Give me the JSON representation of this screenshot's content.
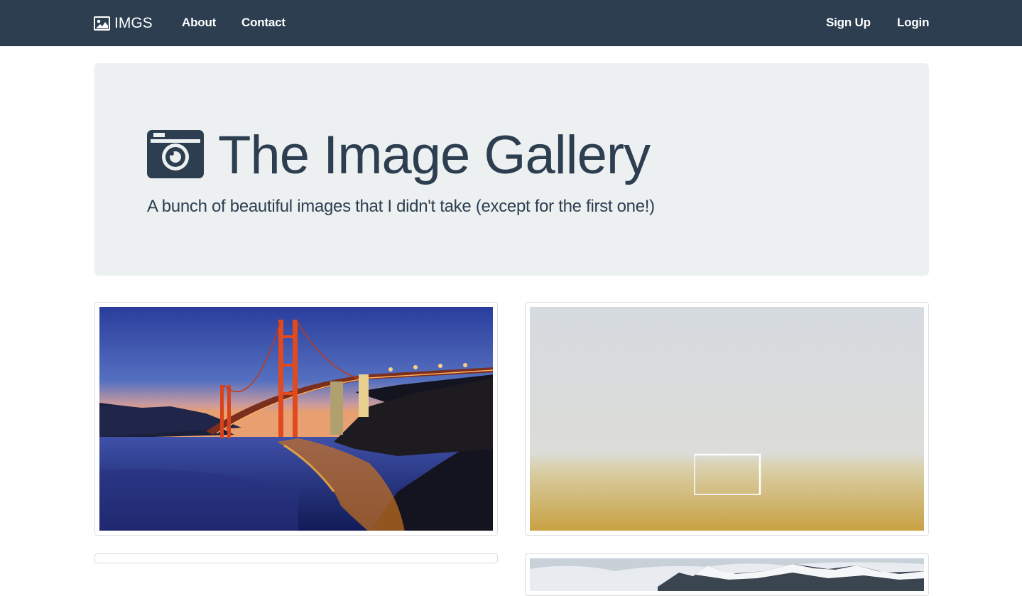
{
  "navbar": {
    "brand": "IMGS",
    "brand_icon": "image-icon",
    "links_left": [
      "About",
      "Contact"
    ],
    "links_right": [
      "Sign Up",
      "Login"
    ],
    "bg_color": "#2c3e50"
  },
  "jumbotron": {
    "icon": "camera-icon",
    "title": "The Image Gallery",
    "subtitle": "A bunch of beautiful images that I didn't take (except for the first one!)",
    "bg_color": "#ecf0f1"
  },
  "gallery": {
    "images": [
      {
        "subject": "golden-gate-bridge-night"
      },
      {
        "subject": "foggy-soccer-field"
      },
      {
        "subject": "empty-thumbnail"
      },
      {
        "subject": "snowy-mountains"
      }
    ]
  }
}
